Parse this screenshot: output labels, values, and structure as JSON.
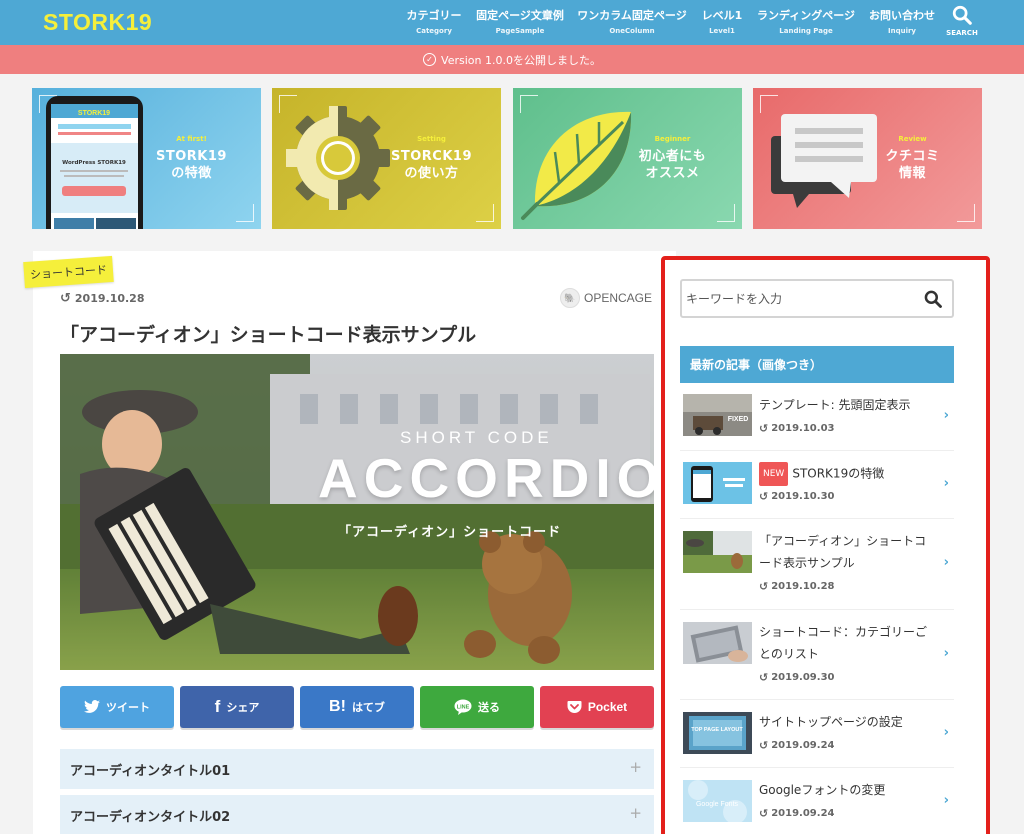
{
  "header": {
    "logo": "STORK19",
    "nav": [
      {
        "label": "カテゴリー",
        "sub": "Category"
      },
      {
        "label": "固定ページ文章例",
        "sub": "PageSample"
      },
      {
        "label": "ワンカラム固定ページ",
        "sub": "OneColumn"
      },
      {
        "label": "レベル1",
        "sub": "Level1"
      },
      {
        "label": "ランディングページ",
        "sub": "Landing Page"
      },
      {
        "label": "お問い合わせ",
        "sub": "Inquiry"
      }
    ],
    "search_label": "SEARCH"
  },
  "announce": {
    "text": "Version 1.0.0を公開しました。"
  },
  "cards": [
    {
      "en": "At first!",
      "jp1": "STORK19",
      "jp2": "の特徴",
      "bg": "#5ab4dc"
    },
    {
      "en": "Setting",
      "jp1": "STORCK19",
      "jp2": "の使い方",
      "bg": "#d2c236"
    },
    {
      "en": "Beginner",
      "jp1": "初心者にも",
      "jp2": "オススメ",
      "bg": "#6cc79a"
    },
    {
      "en": "Review",
      "jp1": "クチコミ",
      "jp2": "情報",
      "bg": "#f08585"
    }
  ],
  "card_phone": {
    "brand": "STORK19",
    "headline": "WordPress STORK19"
  },
  "article": {
    "category": "ショートコード",
    "date": "2019.10.28",
    "author": "OPENCAGE",
    "title": "「アコーディオン」ショートコード表示サンプル",
    "hero_sub": "SHORT CODE",
    "hero_main": "ACCORDION",
    "hero_jp": "「アコーディオン」ショートコード"
  },
  "share": [
    {
      "label": "ツイート",
      "color": "#4fa3e0",
      "icon": "twitter-icon"
    },
    {
      "label": "シェア",
      "color": "#3f64aa",
      "icon": "facebook-icon"
    },
    {
      "label": "はてブ",
      "color": "#3a78c7",
      "icon": "hatena-icon"
    },
    {
      "label": "送る",
      "color": "#3ea93e",
      "icon": "line-icon"
    },
    {
      "label": "Pocket",
      "color": "#e24152",
      "icon": "pocket-icon"
    }
  ],
  "accordion": [
    {
      "title": "アコーディオンタイトル01"
    },
    {
      "title": "アコーディオンタイトル02"
    }
  ],
  "sidebar": {
    "search_placeholder": "キーワードを入力",
    "widget_title": "最新の記事（画像つき）",
    "posts": [
      {
        "title1": "テンプレート: 先頭固定表示",
        "title2": "",
        "date": "2019.10.03",
        "badge": ""
      },
      {
        "title1": "STORK19の特徴",
        "title2": "",
        "date": "2019.10.30",
        "badge": "NEW"
      },
      {
        "title1": "「アコーディオン」ショートコ",
        "title2": "ード表示サンプル",
        "date": "2019.10.28",
        "badge": ""
      },
      {
        "title1": "ショートコード：カテゴリーご",
        "title2": "とのリスト",
        "date": "2019.09.30",
        "badge": ""
      },
      {
        "title1": "サイトトップページの設定",
        "title2": "",
        "date": "2019.09.24",
        "badge": ""
      },
      {
        "title1": "Googleフォントの変更",
        "title2": "",
        "date": "2019.09.24",
        "badge": ""
      }
    ],
    "thumb_texts": [
      "FIXED",
      "TOP PAGE LAYOUT",
      "Google Fonts"
    ]
  }
}
